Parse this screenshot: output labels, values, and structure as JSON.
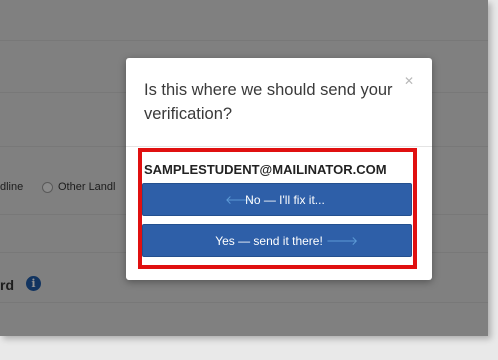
{
  "background": {
    "radio_options": [
      "dline",
      "Other Landl"
    ],
    "field_label_fragment": "rd",
    "info_icon": "info-icon"
  },
  "modal": {
    "title": "Is this where we should send your verification?",
    "close_icon": "close-icon",
    "email": "SAMPLESTUDENT@MAILINATOR.COM",
    "no_button": {
      "label": "No — I'll fix it...",
      "icon": "arrow-left-icon"
    },
    "yes_button": {
      "label": "Yes — send it there!",
      "icon": "arrow-right-icon"
    }
  },
  "colors": {
    "button": "#2e5fa8",
    "highlight": "#e01010",
    "overlay": "#6e6e6e"
  }
}
